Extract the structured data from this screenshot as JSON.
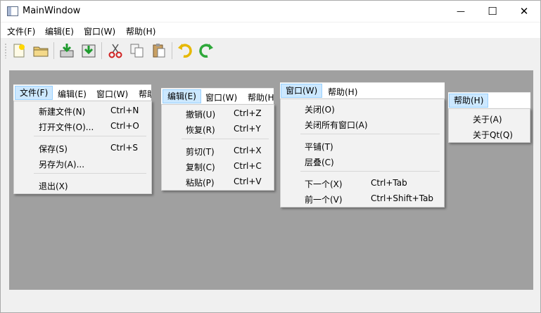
{
  "window": {
    "title": "MainWindow",
    "minimize_glyph": "—",
    "maximize_glyph": "☐",
    "close_glyph": "✕"
  },
  "menubar": [
    "文件(F)",
    "编辑(E)",
    "窗口(W)",
    "帮助(H)"
  ],
  "toolbar": {
    "icons": [
      "new-file-icon",
      "open-file-icon",
      "save-icon",
      "save-as-icon",
      "cut-icon",
      "copy-icon",
      "paste-icon",
      "undo-icon",
      "redo-icon"
    ]
  },
  "sub1": {
    "menus": [
      "文件(F)",
      "编辑(E)",
      "窗口(W)",
      "帮助"
    ],
    "items": [
      {
        "label": "新建文件(N)",
        "shortcut": "Ctrl+N"
      },
      {
        "label": "打开文件(O)...",
        "shortcut": "Ctrl+O"
      },
      {
        "label": "保存(S)",
        "shortcut": "Ctrl+S"
      },
      {
        "label": "另存为(A)...",
        "shortcut": ""
      },
      {
        "label": "退出(X)",
        "shortcut": ""
      }
    ]
  },
  "sub2": {
    "menus": [
      "编辑(E)",
      "窗口(W)",
      "帮助(H"
    ],
    "items": [
      {
        "label": "撤销(U)",
        "shortcut": "Ctrl+Z"
      },
      {
        "label": "恢复(R)",
        "shortcut": "Ctrl+Y"
      },
      {
        "label": "剪切(T)",
        "shortcut": "Ctrl+X"
      },
      {
        "label": "复制(C)",
        "shortcut": "Ctrl+C"
      },
      {
        "label": "粘贴(P)",
        "shortcut": "Ctrl+V"
      }
    ]
  },
  "sub3": {
    "menus": [
      "窗口(W)",
      "帮助(H)"
    ],
    "items": [
      {
        "label": "关闭(O)",
        "shortcut": ""
      },
      {
        "label": "关闭所有窗口(A)",
        "shortcut": ""
      },
      {
        "label": "平铺(T)",
        "shortcut": ""
      },
      {
        "label": "层叠(C)",
        "shortcut": ""
      },
      {
        "label": "下一个(X)",
        "shortcut": "Ctrl+Tab"
      },
      {
        "label": "前一个(V)",
        "shortcut": "Ctrl+Shift+Tab"
      }
    ]
  },
  "sub4": {
    "menus": [
      "帮助(H)"
    ],
    "items": [
      {
        "label": "关于(A)",
        "shortcut": ""
      },
      {
        "label": "关于Qt(Q)",
        "shortcut": ""
      }
    ]
  },
  "colors": {
    "mdi_background": "#a0a0a0",
    "menu_highlight": "#cce8ff",
    "menu_highlight_border": "#99d1ff"
  }
}
